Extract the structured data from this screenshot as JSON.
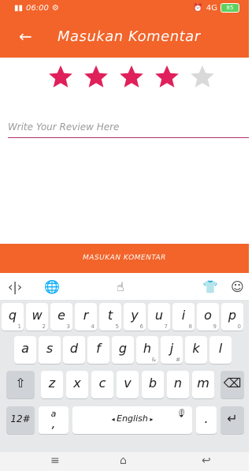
{
  "status_bar": {
    "signal_text": "4G 4G",
    "time": "06:00",
    "right_text": "4G",
    "battery": "85"
  },
  "app_bar": {
    "title": "Masukan Komentar",
    "back_icon": "arrow-left-icon"
  },
  "rating": {
    "value": 4,
    "max": 5,
    "filled_color": "#e0205a",
    "empty_color": "#d9d9d9"
  },
  "review": {
    "placeholder": "Write Your Review Here",
    "value": ""
  },
  "submit_button": {
    "label": "MASUKAN KOMENTAR"
  },
  "accent_color": "#f2642a",
  "keyboard": {
    "toolbar_icons": [
      "cursor-icon",
      "globe-icon",
      "gesture-icon",
      "shirt-icon",
      "emoji-icon"
    ],
    "row1": [
      {
        "k": "q",
        "s": "1"
      },
      {
        "k": "w",
        "s": "2"
      },
      {
        "k": "e",
        "s": "3"
      },
      {
        "k": "r",
        "s": "4"
      },
      {
        "k": "t",
        "s": "5"
      },
      {
        "k": "y",
        "s": "6"
      },
      {
        "k": "u",
        "s": "7"
      },
      {
        "k": "i",
        "s": "8"
      },
      {
        "k": "o",
        "s": "9"
      },
      {
        "k": "p",
        "s": "0"
      }
    ],
    "row2": [
      {
        "k": "a",
        "s": ""
      },
      {
        "k": "s",
        "s": ""
      },
      {
        "k": "d",
        "s": ""
      },
      {
        "k": "f",
        "s": ""
      },
      {
        "k": "g",
        "s": ""
      },
      {
        "k": "h",
        "s": "&"
      },
      {
        "k": "j",
        "s": "#"
      },
      {
        "k": "k",
        "s": ""
      },
      {
        "k": "l",
        "s": ""
      }
    ],
    "row3": [
      {
        "k": "z",
        "s": ""
      },
      {
        "k": "x",
        "s": ""
      },
      {
        "k": "c",
        "s": ""
      },
      {
        "k": "v",
        "s": ""
      },
      {
        "k": "b",
        "s": ""
      },
      {
        "k": "n",
        "s": ""
      },
      {
        "k": "m",
        "s": ""
      }
    ],
    "symbols_label": "12#",
    "comma_top": "a",
    "comma_label": ",",
    "space_label": "English",
    "period_label": "."
  }
}
